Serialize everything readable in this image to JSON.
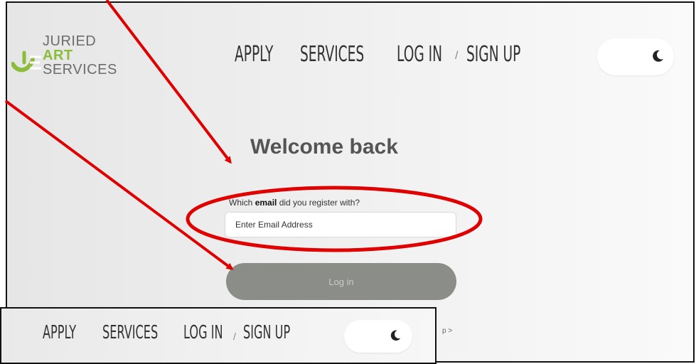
{
  "brand": {
    "line1": "JURIED",
    "line2": "ART",
    "line3": "SERVICES",
    "green": "#8bbd3a"
  },
  "nav": {
    "apply": "APPLY",
    "services": "SERVICES",
    "login": "LOG IN",
    "separator": "/",
    "signup": "SIGN UP",
    "theme_toggle_icon": "moon-icon"
  },
  "login_form": {
    "title": "Welcome back",
    "email_label_prefix": "Which ",
    "email_label_bold": "email",
    "email_label_suffix": " did you register with?",
    "email_placeholder": "Enter Email Address",
    "email_value": "",
    "submit_label": "Log in",
    "right_hint": "p >"
  },
  "annotations": {
    "color": "#e00000"
  }
}
